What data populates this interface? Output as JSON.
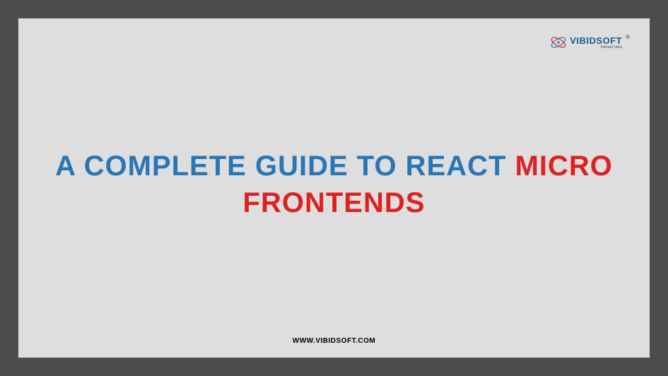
{
  "logo": {
    "brand": "VIBIDSOFT",
    "tagline": "Vibrant Idea",
    "registered": "®"
  },
  "title": {
    "part1": "A COMPLETE GUIDE TO REACT ",
    "part2": "MICRO FRONTENDS"
  },
  "footer": {
    "url": "WWW.VIBIDSOFT.COM"
  }
}
